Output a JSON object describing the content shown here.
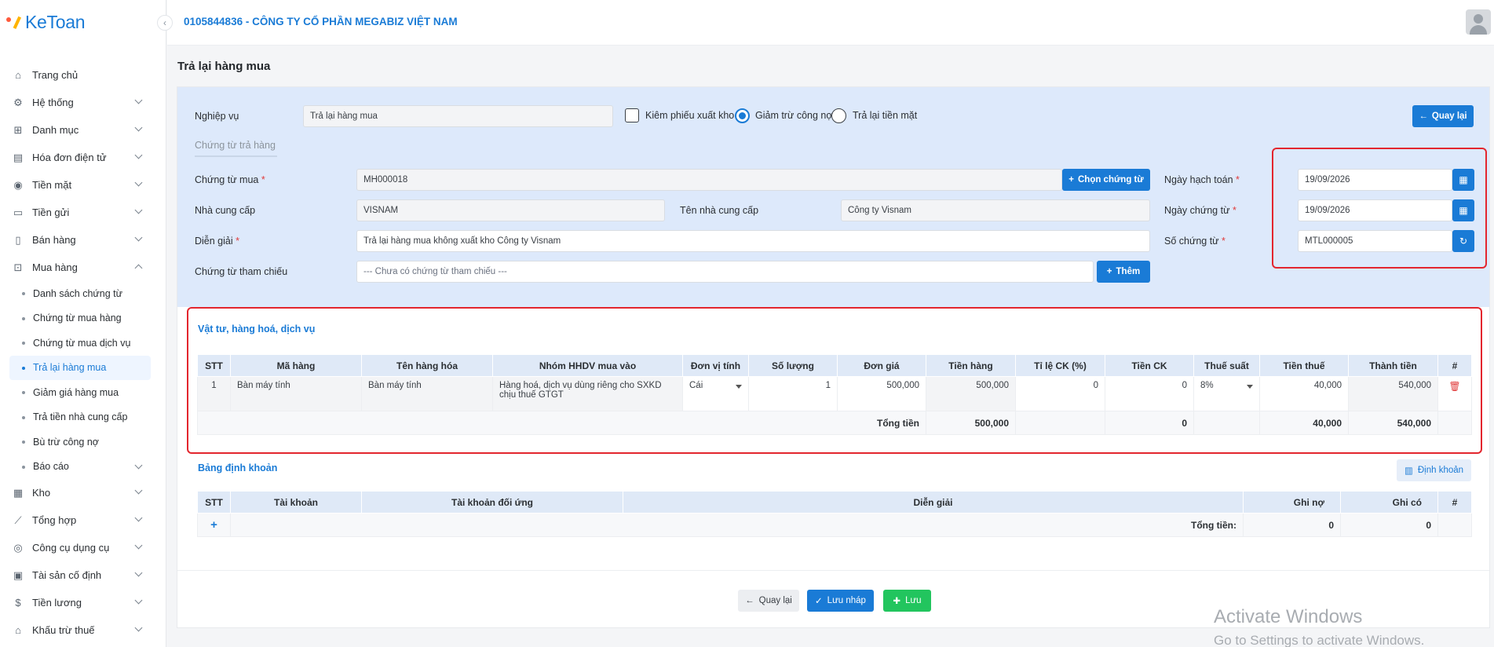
{
  "app": {
    "logo_text": "KeToan",
    "company": "0105844836 - CÔNG TY CỔ PHẦN MEGABIZ VIỆT NAM"
  },
  "sidebar": {
    "items": [
      {
        "label": "Trang chủ",
        "icon": "home-icon"
      },
      {
        "label": "Hệ thống",
        "icon": "gear-icon"
      },
      {
        "label": "Danh mục",
        "icon": "grid-icon"
      },
      {
        "label": "Hóa đơn điện tử",
        "icon": "invoice-icon"
      },
      {
        "label": "Tiền mặt",
        "icon": "cash-icon"
      },
      {
        "label": "Tiền gửi",
        "icon": "bank-card-icon"
      },
      {
        "label": "Bán hàng",
        "icon": "clipboard-icon"
      },
      {
        "label": "Mua hàng",
        "icon": "cart-icon"
      }
    ],
    "sub_items": [
      "Danh sách chứng từ",
      "Chứng từ mua hàng",
      "Chứng từ mua dịch vụ",
      "Trả lại hàng mua",
      "Giảm giá hàng mua",
      "Trả tiền nhà cung cấp",
      "Bù trừ công nợ",
      "Báo cáo"
    ],
    "items_after": [
      {
        "label": "Kho",
        "icon": "warehouse-icon"
      },
      {
        "label": "Tổng hợp",
        "icon": "chart-line-icon"
      },
      {
        "label": "Công cụ dụng cụ",
        "icon": "tools-icon"
      },
      {
        "label": "Tài sản cố định",
        "icon": "car-icon"
      },
      {
        "label": "Tiền lương",
        "icon": "dollar-icon"
      },
      {
        "label": "Khấu trừ thuế",
        "icon": "bank-icon"
      }
    ]
  },
  "page": {
    "title": "Trả lại hàng mua"
  },
  "form": {
    "nghiep_vu_label": "Nghiệp vụ",
    "nghiep_vu_value": "Trả lại hàng mua",
    "kiem_phieu_label": "Kiêm phiếu xuất kho",
    "giam_tru_label": "Giảm trừ công nợ",
    "tra_lai_tien_label": "Trả lại tiền mặt",
    "back_label": "Quay lại",
    "subtab": "Chứng từ trả hàng",
    "chung_tu_mua_label": "Chứng từ mua",
    "chung_tu_mua_value": "MH000018",
    "chon_chung_tu_label": "Chọn chứng từ",
    "nha_cc_label": "Nhà cung cấp",
    "nha_cc_value": "VISNAM",
    "ten_ncc_label": "Tên nhà cung cấp",
    "ten_ncc_value": "Công ty Visnam",
    "dien_giai_label": "Diễn giải",
    "dien_giai_value": "Trả lại hàng mua không xuất kho Công ty Visnam",
    "tham_chieu_label": "Chứng từ tham chiếu",
    "tham_chieu_placeholder": "--- Chưa có chứng từ tham chiếu ---",
    "them_label": "Thêm",
    "ngay_hach_toan_label": "Ngày hạch toán",
    "ngay_hach_toan_value": "19/09/2026",
    "ngay_chung_tu_label": "Ngày chứng từ",
    "ngay_chung_tu_value": "19/09/2026",
    "so_chung_tu_label": "Số chứng từ",
    "so_chung_tu_value": "MTL000005",
    "required_mark": "*"
  },
  "goods": {
    "title": "Vật tư, hàng hoá, dịch vụ",
    "headers": [
      "STT",
      "Mã hàng",
      "Tên hàng hóa",
      "Nhóm HHDV mua vào",
      "Đơn vị tính",
      "Số lượng",
      "Đơn giá",
      "Tiền hàng",
      "Tỉ lệ CK (%)",
      "Tiền CK",
      "Thuế suất",
      "Tiền thuế",
      "Thành tiền",
      "#"
    ],
    "row": {
      "stt": "1",
      "ma": "Bàn máy tính",
      "ten": "Bàn máy tính",
      "nhom": "Hàng hoá, dịch vụ dùng riêng cho SXKD chịu thuế GTGT",
      "dvt": "Cái",
      "sl": "1",
      "don_gia": "500,000",
      "tien_hang": "500,000",
      "ck_pct": "0",
      "tien_ck": "0",
      "thue_suat": "8%",
      "tien_thue": "40,000",
      "thanh_tien": "540,000"
    },
    "total": {
      "label": "Tổng tiền",
      "tien_hang": "500,000",
      "tien_ck": "0",
      "tien_thue": "40,000",
      "thanh_tien": "540,000"
    }
  },
  "accounting": {
    "title": "Bảng định khoản",
    "button": "Định khoản",
    "headers": [
      "STT",
      "Tài khoản",
      "Tài khoản đối ứng",
      "Diễn giải",
      "Ghi nợ",
      "Ghi có",
      "#"
    ],
    "add": "+",
    "total_label": "Tổng tiền:",
    "total_no": "0",
    "total_co": "0"
  },
  "footer": {
    "back": "Quay lại",
    "draft": "Lưu nháp",
    "save": "Lưu"
  },
  "watermark": {
    "line1": "Activate Windows",
    "line2": "Go to Settings to activate Windows."
  },
  "colors": {
    "accent": "#1a7bd6",
    "panel": "#dde9fb",
    "highlight": "#e3262e",
    "save": "#22c55e"
  }
}
